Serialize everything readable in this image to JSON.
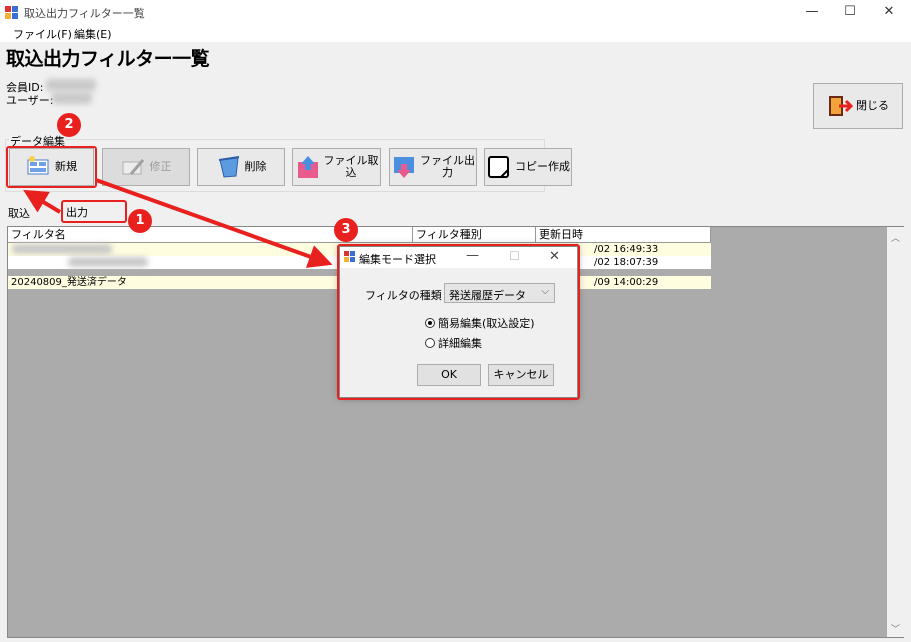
{
  "window": {
    "title": "取込出力フィルター一覧",
    "minimize": "—",
    "maximize": "☐",
    "close": "✕"
  },
  "menu": {
    "file": "ファイル(F)",
    "edit": "編集(E)"
  },
  "page": {
    "title": "取込出力フィルター一覧",
    "member_id_label": "会員ID:",
    "user_label": "ユーザー:"
  },
  "toolbar": {
    "close_label": "閉じる",
    "group_label": "データ編集",
    "new_label": "新規",
    "modify_label": "修正",
    "delete_label": "削除",
    "import_label": "ファイル取\n込",
    "export_label": "ファイル出\n力",
    "copy_label": "コピー作成"
  },
  "tabs": {
    "import": "取込",
    "output": "出力"
  },
  "table": {
    "headers": [
      "フィルタ名",
      "フィルタ種別",
      "更新日時"
    ],
    "rows": [
      {
        "name": "",
        "type": "",
        "updated": "/02 16:49:33"
      },
      {
        "name": "",
        "type": "",
        "updated": "/02 18:07:39"
      },
      {
        "name": "20240809_発送済データ",
        "type": "",
        "updated": "/09 14:00:29"
      }
    ]
  },
  "annotations": {
    "step1": "1",
    "step2": "2",
    "step3": "3"
  },
  "dialog": {
    "title": "編集モード選択",
    "filter_type_label": "フィルタの種類",
    "filter_type_value": "発送履歴データ",
    "option_simple": "簡易編集(取込設定)",
    "option_detail": "詳細編集",
    "ok_label": "OK",
    "cancel_label": "キャンセル",
    "selected_option": "simple"
  },
  "colors": {
    "annotation_red": "#e8211f",
    "row_highlight": "#fffde0",
    "grid_background": "#ababab"
  }
}
